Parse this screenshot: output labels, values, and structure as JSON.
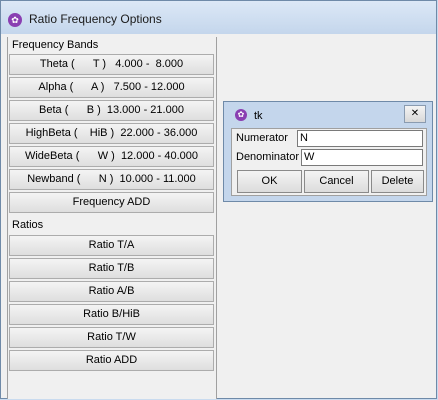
{
  "window": {
    "title": "Ratio Frequency Options"
  },
  "frequency_bands": {
    "label": "Frequency Bands",
    "items": [
      {
        "label": "Theta (      T )   4.000 -  8.000"
      },
      {
        "label": "Alpha (      A )   7.500 - 12.000"
      },
      {
        "label": "Beta (      B )  13.000 - 21.000"
      },
      {
        "label": "HighBeta (    HiB )  22.000 - 36.000"
      },
      {
        "label": "WideBeta (      W )  12.000 - 40.000"
      },
      {
        "label": "Newband (      N )  10.000 - 11.000"
      }
    ],
    "add_label": "Frequency ADD"
  },
  "ratios": {
    "label": "Ratios",
    "items": [
      {
        "label": "Ratio T/A"
      },
      {
        "label": "Ratio T/B"
      },
      {
        "label": "Ratio A/B"
      },
      {
        "label": "Ratio B/HiB"
      },
      {
        "label": "Ratio T/W"
      }
    ],
    "add_label": "Ratio ADD"
  },
  "dialog": {
    "title": "tk",
    "close_glyph": "✕",
    "numerator_label": "Numerator",
    "numerator_value": "N",
    "denominator_label": "Denominator",
    "denominator_value": "W",
    "ok_label": "OK",
    "cancel_label": "Cancel",
    "delete_label": "Delete"
  },
  "icons": {
    "app_icon": "tk-feather-icon"
  }
}
